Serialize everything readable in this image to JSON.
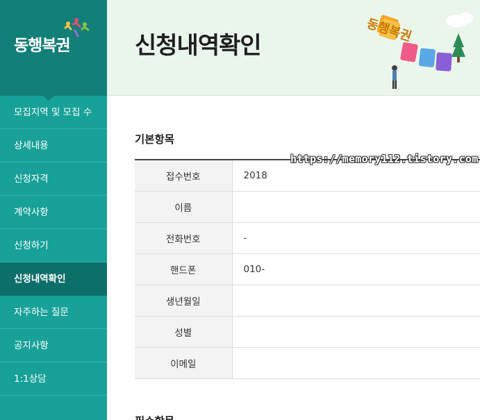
{
  "brand": {
    "logo_text": "동행복권",
    "colors": {
      "sidebar": "#17a198",
      "logo_bg": "#127f78",
      "active": "#0d6f69",
      "header_bg": "#eaf6ec"
    }
  },
  "sidebar": {
    "items": [
      {
        "label": "모집지역 및 모집 수",
        "active": false
      },
      {
        "label": "상세내용",
        "active": false
      },
      {
        "label": "신청자격",
        "active": false
      },
      {
        "label": "계약사항",
        "active": false
      },
      {
        "label": "신청하기",
        "active": false
      },
      {
        "label": "신청내역확인",
        "active": true
      },
      {
        "label": "자주하는 질문",
        "active": false
      },
      {
        "label": "공지사항",
        "active": false
      },
      {
        "label": "1:1상담",
        "active": false
      }
    ]
  },
  "header": {
    "title": "신청내역확인",
    "art_text": "동행복권"
  },
  "main": {
    "section_basic": "기본항목",
    "section_required": "필수항목",
    "rows": [
      {
        "label": "접수번호",
        "value": "2018"
      },
      {
        "label": "이름",
        "value": ""
      },
      {
        "label": "전화번호",
        "value": "-"
      },
      {
        "label": "핸드폰",
        "value": "010-"
      },
      {
        "label": "생년월일",
        "value": ""
      },
      {
        "label": "성별",
        "value": ""
      },
      {
        "label": "이메일",
        "value": ""
      }
    ]
  },
  "watermark": "https://memory112.tistory.com"
}
